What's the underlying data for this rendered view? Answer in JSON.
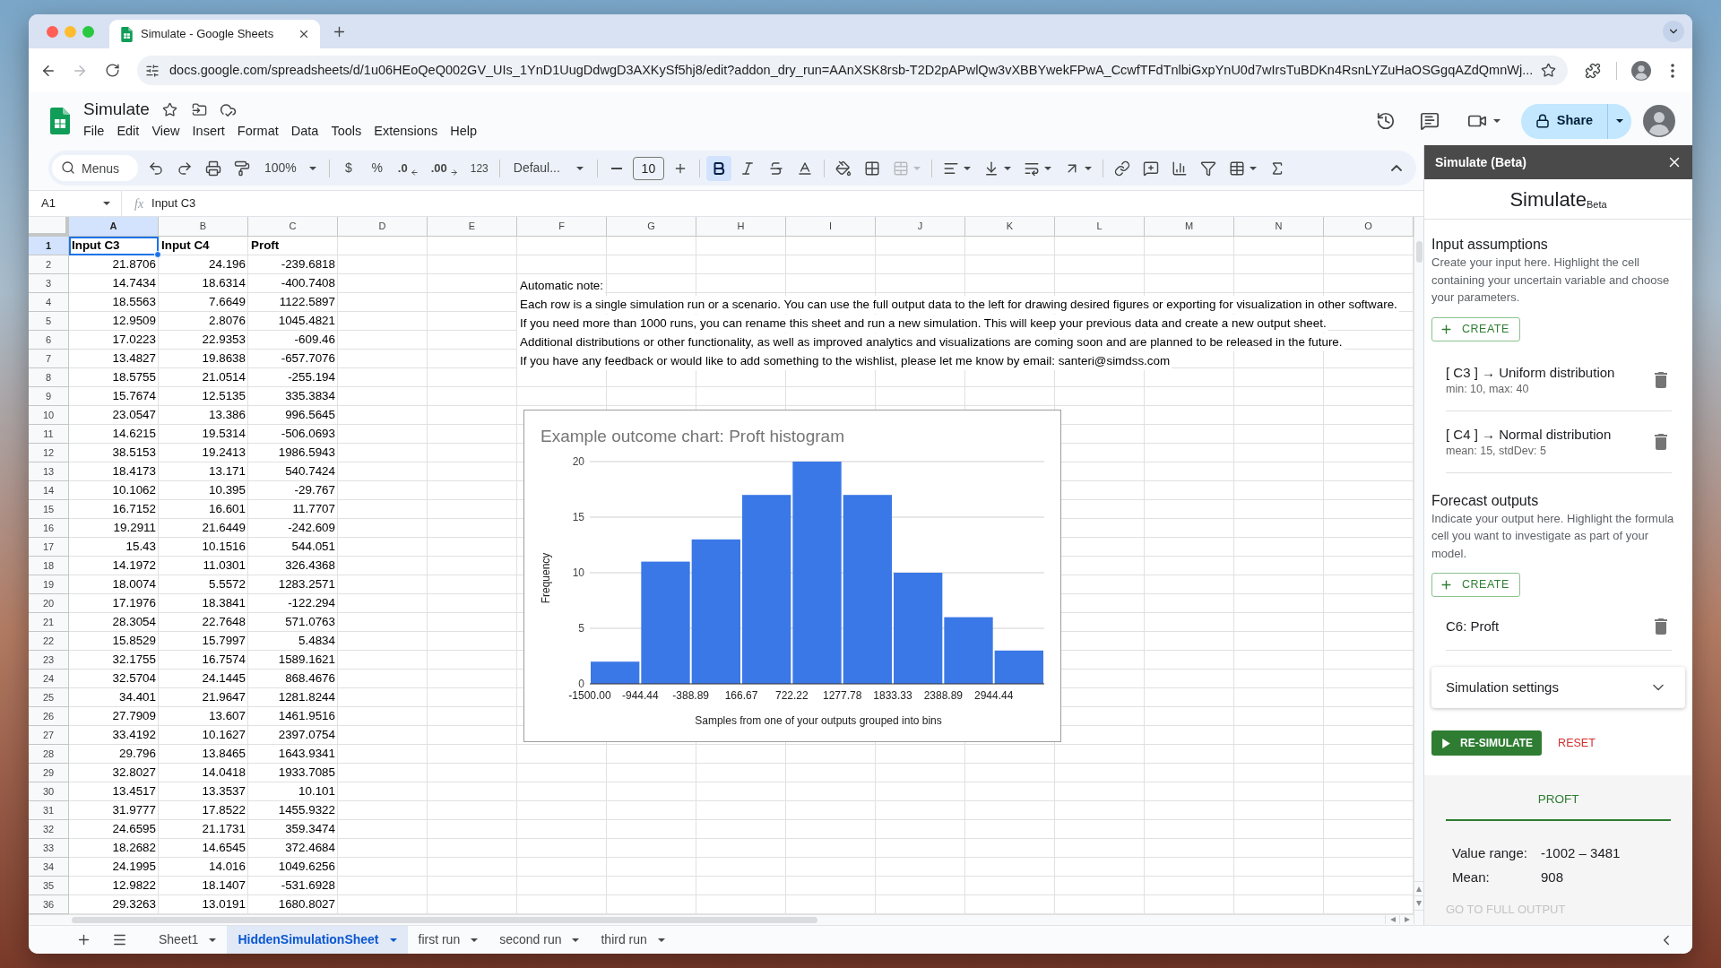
{
  "browser": {
    "tab_title": "Simulate - Google Sheets",
    "forward": {
      "disabled": true
    },
    "url": "docs.google.com/spreadsheets/d/1u06HEoQeQ002GV_UIs_1YnD1UugDdwgD3AXKySf5hj8/edit?addon_dry_run=AAnXSK8rsb-T2D2pAPwlQw3vXBBYwekFPwA_CcwfTFdTnlbiGxpYnU0d7wIrsTuBDKn4RsnLYZuHaOSGgqAZdQmnWj..."
  },
  "app": {
    "title": "Simulate",
    "menus": [
      "File",
      "Edit",
      "View",
      "Insert",
      "Format",
      "Data",
      "Tools",
      "Extensions",
      "Help"
    ],
    "share": "Share"
  },
  "toolbar": {
    "search": {
      "placeholder": "Menus"
    },
    "zoom": "100%",
    "currency": "$",
    "percent": "%",
    "decrease_decimals": ".0",
    "increase_decimals": ".00",
    "number_format": "123",
    "font": "Defaul...",
    "font_size": "10",
    "styles": [
      {
        "kind": "bold",
        "on": true
      },
      {
        "kind": "italic",
        "on": false
      },
      {
        "kind": "strikethrough",
        "on": false
      }
    ],
    "merge_cells": {
      "disabled": true
    }
  },
  "formula_bar": {
    "name_box": "A1",
    "function_label": "fx",
    "formula": "Input C3"
  },
  "grid": {
    "columns": [
      {
        "label": "A",
        "selected": true
      },
      {
        "label": "B",
        "selected": false
      },
      {
        "label": "C",
        "selected": false
      },
      {
        "label": "D",
        "selected": false
      },
      {
        "label": "E",
        "selected": false
      },
      {
        "label": "F",
        "selected": false
      },
      {
        "label": "G",
        "selected": false
      },
      {
        "label": "H",
        "selected": false
      },
      {
        "label": "I",
        "selected": false
      },
      {
        "label": "J",
        "selected": false
      },
      {
        "label": "K",
        "selected": false
      },
      {
        "label": "L",
        "selected": false
      },
      {
        "label": "M",
        "selected": false
      },
      {
        "label": "N",
        "selected": false
      },
      {
        "label": "O",
        "selected": false
      }
    ],
    "rows": [
      {
        "number": "1",
        "selected": true,
        "kind": "header",
        "cells": [
          "Input C3",
          "Input C4",
          "Proft"
        ]
      },
      {
        "number": "2",
        "selected": false,
        "kind": "data",
        "cells": [
          "21.8706",
          "24.196",
          "-239.6818"
        ]
      },
      {
        "number": "3",
        "selected": false,
        "kind": "data",
        "cells": [
          "14.7434",
          "18.6314",
          "-400.7408"
        ],
        "note": "Automatic note:"
      },
      {
        "number": "4",
        "selected": false,
        "kind": "data",
        "cells": [
          "18.5563",
          "7.6649",
          "1122.5897"
        ],
        "note": "Each row is a single simulation run or a scenario. You can use the full output data to the left for drawing desired figures or exporting for visualization in other software."
      },
      {
        "number": "5",
        "selected": false,
        "kind": "data",
        "cells": [
          "12.9509",
          "2.8076",
          "1045.4821"
        ],
        "note": "If you need more than 1000 runs, you can rename this sheet and run a new simulation. This will keep your previous data and create a new output sheet."
      },
      {
        "number": "6",
        "selected": false,
        "kind": "data",
        "cells": [
          "17.0223",
          "22.9353",
          "-609.46"
        ],
        "note": "Additional distributions or other functionality, as well as improved analytics and visualizations are coming soon and are planned to be released in the future."
      },
      {
        "number": "7",
        "selected": false,
        "kind": "data",
        "cells": [
          "13.4827",
          "19.8638",
          "-657.7076"
        ],
        "note": "If you have any feedback or would like to add something to the wishlist, please let me know by email: santeri@simdss.com"
      },
      {
        "number": "8",
        "selected": false,
        "kind": "data",
        "cells": [
          "18.5755",
          "21.0514",
          "-255.194"
        ]
      },
      {
        "number": "9",
        "selected": false,
        "kind": "data",
        "cells": [
          "15.7674",
          "12.5135",
          "335.3834"
        ]
      },
      {
        "number": "10",
        "selected": false,
        "kind": "data",
        "cells": [
          "23.0547",
          "13.386",
          "996.5645"
        ]
      },
      {
        "number": "11",
        "selected": false,
        "kind": "data",
        "cells": [
          "14.6215",
          "19.5314",
          "-506.0693"
        ]
      },
      {
        "number": "12",
        "selected": false,
        "kind": "data",
        "cells": [
          "38.5153",
          "19.2413",
          "1986.5943"
        ]
      },
      {
        "number": "13",
        "selected": false,
        "kind": "data",
        "cells": [
          "18.4173",
          "13.171",
          "540.7424"
        ]
      },
      {
        "number": "14",
        "selected": false,
        "kind": "data",
        "cells": [
          "10.1062",
          "10.395",
          "-29.767"
        ]
      },
      {
        "number": "15",
        "selected": false,
        "kind": "data",
        "cells": [
          "16.7152",
          "16.601",
          "11.7707"
        ]
      },
      {
        "number": "16",
        "selected": false,
        "kind": "data",
        "cells": [
          "19.2911",
          "21.6449",
          "-242.609"
        ]
      },
      {
        "number": "17",
        "selected": false,
        "kind": "data",
        "cells": [
          "15.43",
          "10.1516",
          "544.051"
        ]
      },
      {
        "number": "18",
        "selected": false,
        "kind": "data",
        "cells": [
          "14.1972",
          "11.0301",
          "326.4368"
        ]
      },
      {
        "number": "19",
        "selected": false,
        "kind": "data",
        "cells": [
          "18.0074",
          "5.5572",
          "1283.2571"
        ]
      },
      {
        "number": "20",
        "selected": false,
        "kind": "data",
        "cells": [
          "17.1976",
          "18.3841",
          "-122.294"
        ]
      },
      {
        "number": "21",
        "selected": false,
        "kind": "data",
        "cells": [
          "28.3054",
          "22.7648",
          "571.0763"
        ]
      },
      {
        "number": "22",
        "selected": false,
        "kind": "data",
        "cells": [
          "15.8529",
          "15.7997",
          "5.4834"
        ]
      },
      {
        "number": "23",
        "selected": false,
        "kind": "data",
        "cells": [
          "32.1755",
          "16.7574",
          "1589.1621"
        ]
      },
      {
        "number": "24",
        "selected": false,
        "kind": "data",
        "cells": [
          "32.5704",
          "24.1445",
          "868.4676"
        ]
      },
      {
        "number": "25",
        "selected": false,
        "kind": "data",
        "cells": [
          "34.401",
          "21.9647",
          "1281.8244"
        ]
      },
      {
        "number": "26",
        "selected": false,
        "kind": "data",
        "cells": [
          "27.7909",
          "13.607",
          "1461.9516"
        ]
      },
      {
        "number": "27",
        "selected": false,
        "kind": "data",
        "cells": [
          "33.4192",
          "10.1627",
          "2397.0754"
        ]
      },
      {
        "number": "28",
        "selected": false,
        "kind": "data",
        "cells": [
          "29.796",
          "13.8465",
          "1643.9341"
        ]
      },
      {
        "number": "29",
        "selected": false,
        "kind": "data",
        "cells": [
          "32.8027",
          "14.0418",
          "1933.7085"
        ]
      },
      {
        "number": "30",
        "selected": false,
        "kind": "data",
        "cells": [
          "13.4517",
          "13.3537",
          "10.101"
        ]
      },
      {
        "number": "31",
        "selected": false,
        "kind": "data",
        "cells": [
          "31.9777",
          "17.8522",
          "1455.9322"
        ]
      },
      {
        "number": "32",
        "selected": false,
        "kind": "data",
        "cells": [
          "24.6595",
          "21.1731",
          "359.3474"
        ]
      },
      {
        "number": "33",
        "selected": false,
        "kind": "data",
        "cells": [
          "18.2682",
          "14.6545",
          "372.4684"
        ]
      },
      {
        "number": "34",
        "selected": false,
        "kind": "data",
        "cells": [
          "24.1995",
          "14.016",
          "1049.6256"
        ]
      },
      {
        "number": "35",
        "selected": false,
        "kind": "data",
        "cells": [
          "12.9822",
          "18.1407",
          "-531.6928"
        ]
      },
      {
        "number": "36",
        "selected": false,
        "kind": "data",
        "cells": [
          "29.3263",
          "13.0191",
          "1680.8027"
        ]
      }
    ],
    "chart": {
      "chart_data": {
        "type": "bar",
        "title": "Example outcome chart: Proft histogram",
        "xlabel": "Samples from one of your outputs grouped into bins",
        "ylabel": "Frequency",
        "categories": [
          "-1500.00",
          "-944.44",
          "-388.89",
          "166.67",
          "722.22",
          "1277.78",
          "1833.33",
          "2388.89",
          "2944.44"
        ],
        "values": [
          2,
          11,
          13,
          17,
          20,
          17,
          10,
          6,
          3
        ],
        "ylim": [
          0,
          20
        ],
        "yticks": [
          0,
          5,
          10,
          15,
          20
        ],
        "grid": true
      }
    }
  },
  "side_panel": {
    "title": "Simulate (Beta)",
    "heading": "Simulate$_{Beta}$",
    "sections": [
      {
        "title": "Input assumptions",
        "description": "Create your input here. Highlight the cell containing your uncertain variable and choose your parameters.",
        "button": "CREATE",
        "items": [
          {
            "title": "[ C3 ] → Uniform distribution",
            "detail": "min: 10, max: 40"
          },
          {
            "title": "[ C4 ] → Normal distribution",
            "detail": "mean: 15, stdDev: 5"
          }
        ]
      },
      {
        "title": "Forecast outputs",
        "description": "Indicate your output here. Highlight the formula cell you want to investigate as part of your model.",
        "button": "CREATE",
        "items": [
          {
            "title": "C6: Proft"
          }
        ]
      }
    ],
    "settings": {
      "label": "Simulation settings",
      "expanded": false
    },
    "actions": {
      "run": "RE-SIMULATE",
      "reset": "RESET"
    },
    "results": {
      "tabs": [
        {
          "label": "PROFT",
          "selected": true
        }
      ],
      "stats": [
        {
          "label": "Value range:",
          "value": "-1002 – 3481"
        },
        {
          "label": "Mean:",
          "value": "908"
        }
      ],
      "link": {
        "label": "GO TO FULL OUTPUT",
        "disabled": true
      }
    }
  },
  "sheet_tabs": [
    {
      "label": "Sheet1",
      "selected": false
    },
    {
      "label": "HiddenSimulationSheet",
      "selected": true
    },
    {
      "label": "first run",
      "selected": false
    },
    {
      "label": "second run",
      "selected": false
    },
    {
      "label": "third run",
      "selected": false
    }
  ]
}
